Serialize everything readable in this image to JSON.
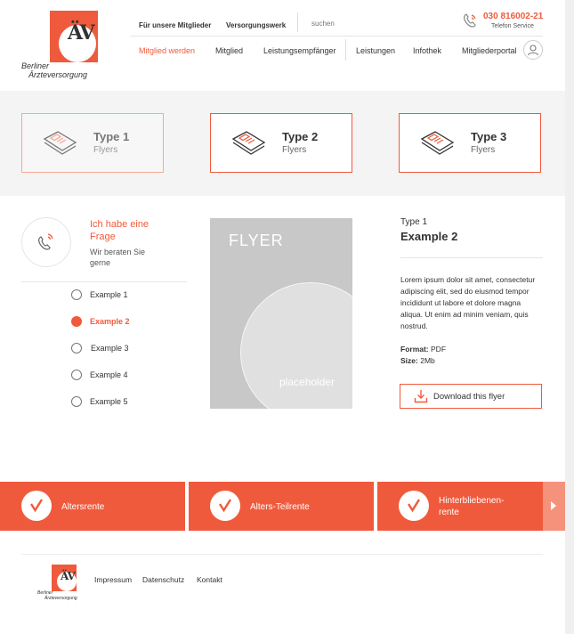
{
  "logo": {
    "mark": "ÄV",
    "line1": "Berliner",
    "line2": "Ärzteversorgung"
  },
  "topnav": {
    "members": "Für unsere Mitglieder",
    "fund": "Versorgungswerk"
  },
  "search": {
    "placeholder": "suchen"
  },
  "contact": {
    "phone": "030 816002-21",
    "label": "Telefon Service"
  },
  "mainnav": {
    "items": [
      "Mitglied werden",
      "Mitglied",
      "Leistungsempfänger",
      "Leistungen",
      "Infothek",
      "Mitgliederportal"
    ],
    "active": "Mitglied werden"
  },
  "types": [
    {
      "title": "Type 1",
      "sub": "Flyers"
    },
    {
      "title": "Type 2",
      "sub": "Flyers"
    },
    {
      "title": "Type 3",
      "sub": "Flyers"
    }
  ],
  "help": {
    "title": "Ich habe eine Frage",
    "sub": "Wir beraten Sie gerne"
  },
  "examples": {
    "items": [
      "Example 1",
      "Example 2",
      "Example 3",
      "Example 4",
      "Example 5"
    ],
    "selected": "Example 2"
  },
  "flyer": {
    "title": "FLYER",
    "placeholder": "placeholder"
  },
  "detail": {
    "type": "Type 1",
    "title": "Example 2",
    "description": "Lorem ipsum dolor sit amet, consectetur adipiscing elit, sed do eiusmod tempor incididunt ut labore et dolore magna aliqua. Ut enim ad minim veniam, quis nostrud.",
    "format_label": "Format:",
    "format_value": "PDF",
    "size_label": "Size:",
    "size_value": "2Mb",
    "download_label": "Download this flyer"
  },
  "tiles": [
    {
      "label": "Altersrente"
    },
    {
      "label": "Alters-Teilrente"
    },
    {
      "label_line1": "Hinterbliebenen-",
      "label_line2": "rente"
    }
  ],
  "footer": {
    "logo_mark": "ÄV",
    "logo_line1": "Berliner",
    "logo_line2": "Ärzteversorgung",
    "links": [
      "Impressum",
      "Datenschutz",
      "Kontakt"
    ]
  },
  "colors": {
    "accent": "#f05a3c",
    "band": "#f4f4f4"
  }
}
